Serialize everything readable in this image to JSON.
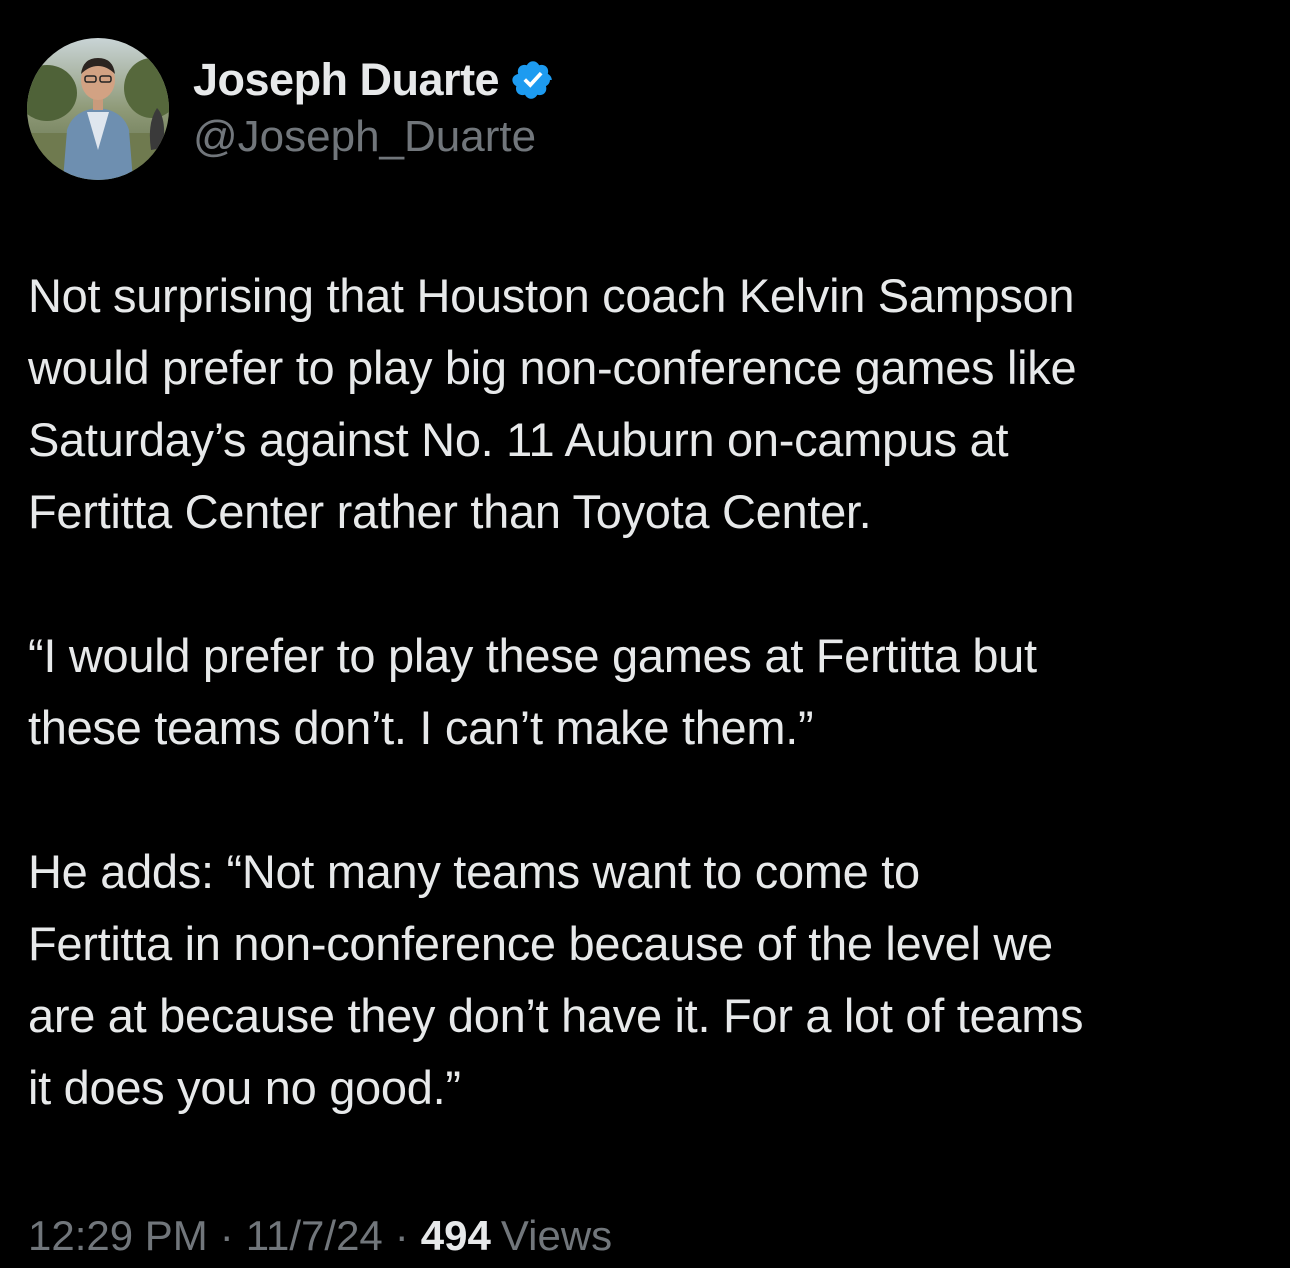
{
  "author": {
    "display_name": "Joseph Duarte",
    "handle": "@Joseph_Duarte",
    "verified_icon": "verified-badge-icon",
    "verified_color": "#1d9bf0"
  },
  "tweet": {
    "paragraphs": [
      {
        "lines": [
          "Not surprising that Houston coach Kelvin Sampson",
          "would prefer to play big non-conference games like",
          "Saturday’s against No. 11 Auburn on-campus at",
          "Fertitta Center rather than Toyota Center."
        ]
      },
      {
        "lines": [
          "“I would prefer to play these games at Fertitta but",
          "these teams don’t. I can’t make them.”"
        ]
      },
      {
        "lines": [
          "He adds: “Not many teams want to come to",
          "Fertitta in non-conference because of the level we",
          "are at because they don’t have it. For a lot of teams",
          "it does you no good.”"
        ]
      }
    ]
  },
  "meta": {
    "time": "12:29 PM",
    "separator": "·",
    "date": "11/7/24",
    "views_count": "494",
    "views_label": "Views"
  },
  "colors": {
    "background": "#000000",
    "primary_text": "#e7e9ea",
    "secondary_text": "#71767b"
  }
}
